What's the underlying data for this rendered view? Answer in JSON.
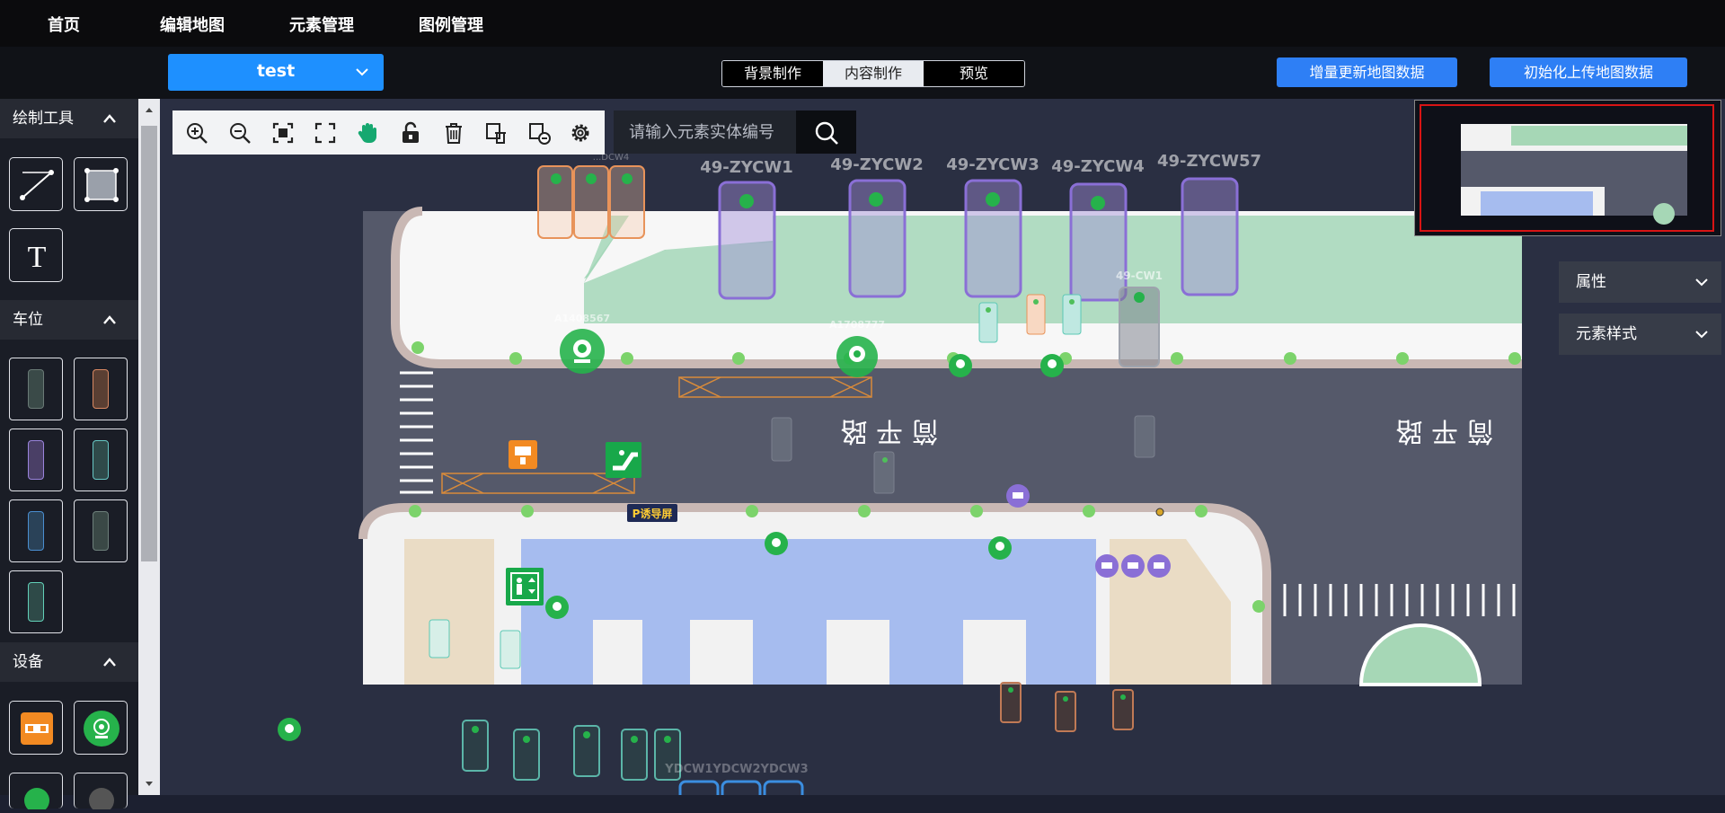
{
  "nav": {
    "items": [
      "首页",
      "编辑地图",
      "元素管理",
      "图例管理"
    ]
  },
  "map_select": {
    "value": "test"
  },
  "modes": {
    "tabs": [
      "背景制作",
      "内容制作",
      "预览"
    ],
    "active": "内容制作"
  },
  "actions": {
    "incremental_update": "增量更新地图数据",
    "init_upload": "初始化上传地图数据"
  },
  "sidebar": {
    "drawing_tools": {
      "title": "绘制工具"
    },
    "parking": {
      "title": "车位"
    },
    "devices": {
      "title": "设备"
    }
  },
  "search": {
    "placeholder": "请输入元素实体编号"
  },
  "panels": {
    "properties": "属性",
    "element_style": "元素样式"
  },
  "map": {
    "space_labels": [
      "49-ZYCW1",
      "49-ZYCW2",
      "49-ZYCW3",
      "49-ZYCW4",
      "49-ZYCW57",
      "49-CW1"
    ],
    "camera_labels": [
      "A1408567",
      "A1708777"
    ],
    "road_label": "简 平 路",
    "guide_screen": "P诱导屏",
    "bottom_label": "YDCW1YDCW2YDCW3",
    "partial_label": "...DCW4"
  },
  "colors": {
    "accent": "#1e90ff",
    "action_blue": "#2e7ff5",
    "device_green": "#26b24b",
    "purple_space": "#8a6fd6",
    "orange_space": "#e8935a",
    "teal_space": "#5cc9b5"
  }
}
